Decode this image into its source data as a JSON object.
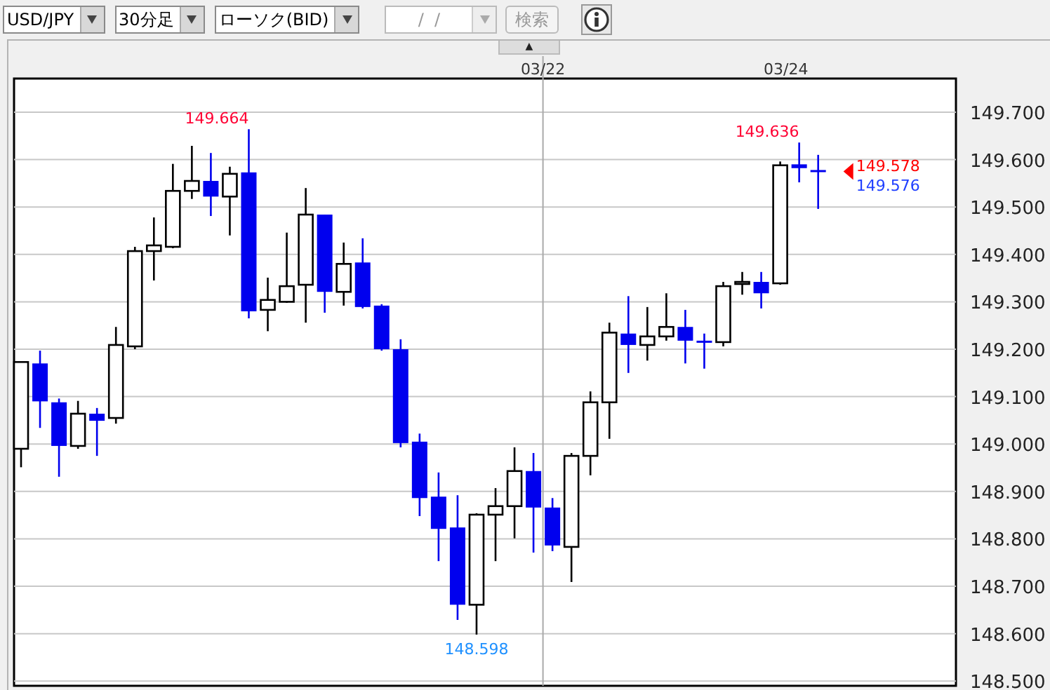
{
  "toolbar": {
    "pair_select": {
      "value": "USD/JPY"
    },
    "interval_select": {
      "value": "30分足"
    },
    "chart_type_select": {
      "value": "ローソク(BID)"
    },
    "date_field": {
      "placeholder": "/  /",
      "disabled": true
    },
    "search_button": {
      "label": "検索",
      "disabled": true
    }
  },
  "chart_panel": {
    "collapse_button": {
      "label": "▲"
    },
    "date_axis": {
      "labels": [
        "03/22",
        "03/24"
      ]
    },
    "price_axis": {
      "labels": [
        "149.700",
        "149.600",
        "149.500",
        "149.400",
        "149.300",
        "149.200",
        "149.100",
        "149.000",
        "148.900",
        "148.800",
        "148.700",
        "148.600",
        "148.500"
      ]
    },
    "price_labels": [
      {
        "kind": "high",
        "text": "149.664",
        "color": "#ff0033"
      },
      {
        "kind": "high",
        "text": "149.636",
        "color": "#ff0033"
      },
      {
        "kind": "low",
        "text": "148.598",
        "color": "#1e90ff"
      },
      {
        "kind": "ask",
        "text": "149.578",
        "color": "#ff0000"
      },
      {
        "kind": "bid",
        "text": "149.576",
        "color": "#2040ff"
      }
    ]
  }
}
